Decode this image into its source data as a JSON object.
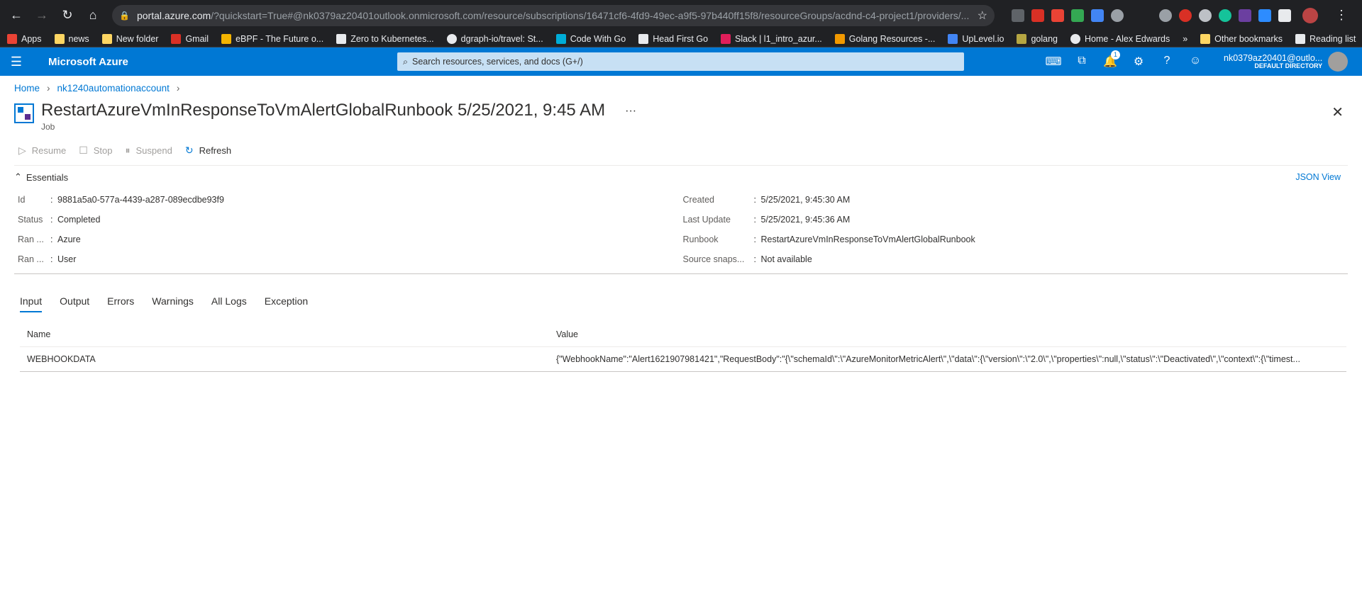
{
  "browser": {
    "url_host": "portal.azure.com",
    "url_rest": "/?quickstart=True#@nk0379az20401outlook.onmicrosoft.com/resource/subscriptions/16471cf6-4fd9-49ec-a9f5-97b440ff15f8/resourceGroups/acdnd-c4-project1/providers/...",
    "bookmarks": [
      "Apps",
      "news",
      "New folder",
      "Gmail",
      "eBPF - The Future o...",
      "Zero to Kubernetes...",
      "dgraph-io/travel: St...",
      "Code With Go",
      "Head First Go",
      "Slack | l1_intro_azur...",
      "Golang Resources -...",
      "UpLevel.io",
      "golang",
      "Home - Alex Edwards"
    ],
    "bookmarks_more": "»",
    "other_bookmarks": "Other bookmarks",
    "reading_list": "Reading list"
  },
  "azure": {
    "brand": "Microsoft Azure",
    "search_placeholder": "Search resources, services, and docs (G+/)",
    "notification_count": "1",
    "account_user": "nk0379az20401@outlo...",
    "account_directory": "DEFAULT DIRECTORY"
  },
  "breadcrumb": [
    "Home",
    "nk1240automationaccount"
  ],
  "page": {
    "title": "RestartAzureVmInResponseToVmAlertGlobalRunbook 5/25/2021, 9:45 AM",
    "subtitle": "Job",
    "more": "···"
  },
  "toolbar": {
    "resume": "Resume",
    "stop": "Stop",
    "suspend": "Suspend",
    "refresh": "Refresh"
  },
  "essentials": {
    "heading": "Essentials",
    "json_view": "JSON View",
    "left": [
      {
        "label": "Id",
        "value": "9881a5a0-577a-4439-a287-089ecdbe93f9"
      },
      {
        "label": "Status",
        "value": "Completed"
      },
      {
        "label": "Ran ...",
        "value": "Azure"
      },
      {
        "label": "Ran ...",
        "value": "User"
      }
    ],
    "right": [
      {
        "label": "Created",
        "value": "5/25/2021, 9:45:30 AM"
      },
      {
        "label": "Last Update",
        "value": "5/25/2021, 9:45:36 AM"
      },
      {
        "label": "Runbook",
        "value": "RestartAzureVmInResponseToVmAlertGlobalRunbook"
      },
      {
        "label": "Source snaps...",
        "value": "Not available"
      }
    ]
  },
  "tabs": [
    "Input",
    "Output",
    "Errors",
    "Warnings",
    "All Logs",
    "Exception"
  ],
  "table": {
    "headers": {
      "name": "Name",
      "value": "Value"
    },
    "rows": [
      {
        "name": "WEBHOOKDATA",
        "value": "{\"WebhookName\":\"Alert1621907981421\",\"RequestBody\":\"{\\\"schemaId\\\":\\\"AzureMonitorMetricAlert\\\",\\\"data\\\":{\\\"version\\\":\\\"2.0\\\",\\\"properties\\\":null,\\\"status\\\":\\\"Deactivated\\\",\\\"context\\\":{\\\"timest..."
      }
    ]
  }
}
